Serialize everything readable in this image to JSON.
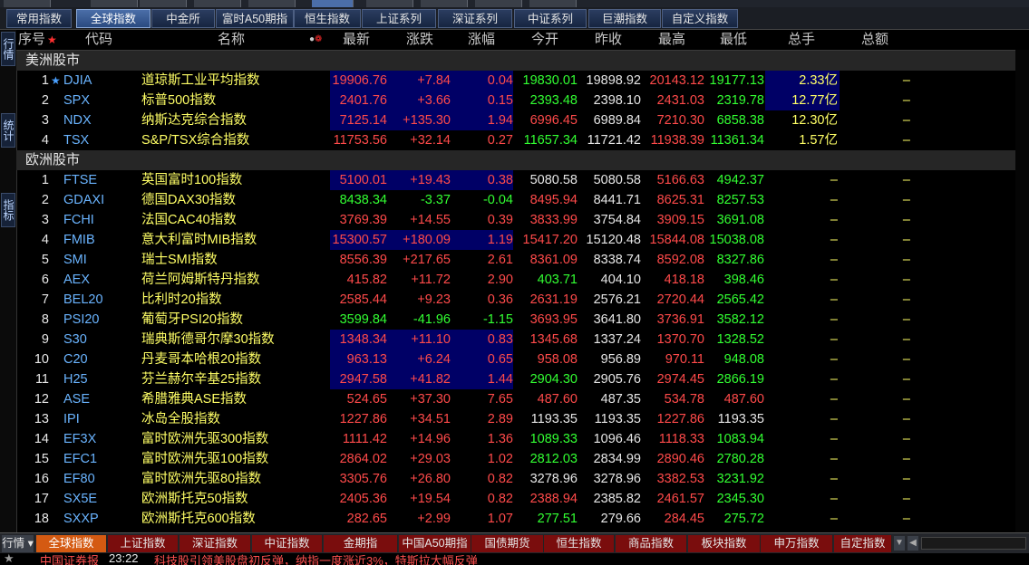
{
  "top_strip_tabs": [
    "...",
    "...",
    "...",
    "...",
    "...",
    "...",
    "...",
    "...",
    "...",
    "..."
  ],
  "category_tabs": [
    "常用指数",
    "全球指数",
    "中金所",
    "富时A50期指",
    "恒生指数",
    "上证系列",
    "深证系列",
    "中证系列",
    "巨潮指数",
    "自定义指数"
  ],
  "active_category": "全球指数",
  "sidebar_tabs": [
    "行情",
    "统计",
    "指标"
  ],
  "columns": {
    "seq": "序号",
    "code": "代码",
    "name": "名称",
    "last": "最新",
    "change": "涨跌",
    "pct": "涨幅",
    "open": "今开",
    "prev": "昨收",
    "high": "最高",
    "low": "最低",
    "volume": "总手",
    "amount": "总额"
  },
  "sections": [
    {
      "title": "美洲股市",
      "rows": [
        {
          "seq": "1",
          "star": "★",
          "code": "DJIA",
          "name": "道琼斯工业平均指数",
          "last": "19906.76",
          "chg": "+7.84",
          "pct": "0.04",
          "open": "19830.01",
          "prev": "19898.92",
          "high": "20143.12",
          "low": "19177.13",
          "vol": "2.33亿",
          "amt": "–",
          "dir": "up",
          "open_dir": "dn",
          "high_dir": "up",
          "low_dir": "dn",
          "hl": true,
          "hl_vol": true
        },
        {
          "seq": "2",
          "star": "",
          "code": "SPX",
          "name": "标普500指数",
          "last": "2401.76",
          "chg": "+3.66",
          "pct": "0.15",
          "open": "2393.48",
          "prev": "2398.10",
          "high": "2431.03",
          "low": "2319.78",
          "vol": "12.77亿",
          "amt": "–",
          "dir": "up",
          "open_dir": "dn",
          "high_dir": "up",
          "low_dir": "dn",
          "hl": true,
          "hl_vol": true
        },
        {
          "seq": "3",
          "star": "",
          "code": "NDX",
          "name": "纳斯达克综合指数",
          "last": "7125.14",
          "chg": "+135.30",
          "pct": "1.94",
          "open": "6996.45",
          "prev": "6989.84",
          "high": "7210.30",
          "low": "6858.38",
          "vol": "12.30亿",
          "amt": "–",
          "dir": "up",
          "open_dir": "up",
          "high_dir": "up",
          "low_dir": "dn",
          "hl": true,
          "hl_vol": false
        },
        {
          "seq": "4",
          "star": "",
          "code": "TSX",
          "name": "S&P/TSX综合指数",
          "last": "11753.56",
          "chg": "+32.14",
          "pct": "0.27",
          "open": "11657.34",
          "prev": "11721.42",
          "high": "11938.39",
          "low": "11361.34",
          "vol": "1.57亿",
          "amt": "–",
          "dir": "up",
          "open_dir": "dn",
          "high_dir": "up",
          "low_dir": "dn",
          "hl": false,
          "hl_vol": false
        }
      ]
    },
    {
      "title": "欧洲股市",
      "rows": [
        {
          "seq": "1",
          "star": "",
          "code": "FTSE",
          "name": "英国富时100指数",
          "last": "5100.01",
          "chg": "+19.43",
          "pct": "0.38",
          "open": "5080.58",
          "prev": "5080.58",
          "high": "5166.63",
          "low": "4942.37",
          "vol": "–",
          "amt": "–",
          "dir": "up",
          "open_dir": "eq",
          "high_dir": "up",
          "low_dir": "dn",
          "hl": true
        },
        {
          "seq": "2",
          "star": "",
          "code": "GDAXI",
          "name": "德国DAX30指数",
          "last": "8438.34",
          "chg": "-3.37",
          "pct": "-0.04",
          "open": "8495.94",
          "prev": "8441.71",
          "high": "8625.31",
          "low": "8257.53",
          "vol": "–",
          "amt": "–",
          "dir": "dn",
          "open_dir": "up",
          "high_dir": "up",
          "low_dir": "dn",
          "hl": false
        },
        {
          "seq": "3",
          "star": "",
          "code": "FCHI",
          "name": "法国CAC40指数",
          "last": "3769.39",
          "chg": "+14.55",
          "pct": "0.39",
          "open": "3833.99",
          "prev": "3754.84",
          "high": "3909.15",
          "low": "3691.08",
          "vol": "–",
          "amt": "–",
          "dir": "up",
          "open_dir": "up",
          "high_dir": "up",
          "low_dir": "dn",
          "hl": false
        },
        {
          "seq": "4",
          "star": "",
          "code": "FMIB",
          "name": "意大利富时MIB指数",
          "last": "15300.57",
          "chg": "+180.09",
          "pct": "1.19",
          "open": "15417.20",
          "prev": "15120.48",
          "high": "15844.08",
          "low": "15038.08",
          "vol": "–",
          "amt": "–",
          "dir": "up",
          "open_dir": "up",
          "high_dir": "up",
          "low_dir": "dn",
          "hl": true
        },
        {
          "seq": "5",
          "star": "",
          "code": "SMI",
          "name": "瑞士SMI指数",
          "last": "8556.39",
          "chg": "+217.65",
          "pct": "2.61",
          "open": "8361.09",
          "prev": "8338.74",
          "high": "8592.08",
          "low": "8327.86",
          "vol": "–",
          "amt": "–",
          "dir": "up",
          "open_dir": "up",
          "high_dir": "up",
          "low_dir": "dn",
          "hl": false
        },
        {
          "seq": "6",
          "star": "",
          "code": "AEX",
          "name": "荷兰阿姆斯特丹指数",
          "last": "415.82",
          "chg": "+11.72",
          "pct": "2.90",
          "open": "403.71",
          "prev": "404.10",
          "high": "418.18",
          "low": "398.46",
          "vol": "–",
          "amt": "–",
          "dir": "up",
          "open_dir": "dn",
          "high_dir": "up",
          "low_dir": "dn",
          "hl": false
        },
        {
          "seq": "7",
          "star": "",
          "code": "BEL20",
          "name": "比利时20指数",
          "last": "2585.44",
          "chg": "+9.23",
          "pct": "0.36",
          "open": "2631.19",
          "prev": "2576.21",
          "high": "2720.44",
          "low": "2565.42",
          "vol": "–",
          "amt": "–",
          "dir": "up",
          "open_dir": "up",
          "high_dir": "up",
          "low_dir": "dn",
          "hl": false
        },
        {
          "seq": "8",
          "star": "",
          "code": "PSI20",
          "name": "葡萄牙PSI20指数",
          "last": "3599.84",
          "chg": "-41.96",
          "pct": "-1.15",
          "open": "3693.95",
          "prev": "3641.80",
          "high": "3736.91",
          "low": "3582.12",
          "vol": "–",
          "amt": "–",
          "dir": "dn",
          "open_dir": "up",
          "high_dir": "up",
          "low_dir": "dn",
          "hl": false
        },
        {
          "seq": "9",
          "star": "",
          "code": "S30",
          "name": "瑞典斯德哥尔摩30指数",
          "last": "1348.34",
          "chg": "+11.10",
          "pct": "0.83",
          "open": "1345.68",
          "prev": "1337.24",
          "high": "1370.70",
          "low": "1328.52",
          "vol": "–",
          "amt": "–",
          "dir": "up",
          "open_dir": "up",
          "high_dir": "up",
          "low_dir": "dn",
          "hl": true
        },
        {
          "seq": "10",
          "star": "",
          "code": "C20",
          "name": "丹麦哥本哈根20指数",
          "last": "963.13",
          "chg": "+6.24",
          "pct": "0.65",
          "open": "958.08",
          "prev": "956.89",
          "high": "970.11",
          "low": "948.08",
          "vol": "–",
          "amt": "–",
          "dir": "up",
          "open_dir": "up",
          "high_dir": "up",
          "low_dir": "dn",
          "hl": true
        },
        {
          "seq": "11",
          "star": "",
          "code": "H25",
          "name": "芬兰赫尔辛基25指数",
          "last": "2947.58",
          "chg": "+41.82",
          "pct": "1.44",
          "open": "2904.30",
          "prev": "2905.76",
          "high": "2974.45",
          "low": "2866.19",
          "vol": "–",
          "amt": "–",
          "dir": "up",
          "open_dir": "dn",
          "high_dir": "up",
          "low_dir": "dn",
          "hl": true
        },
        {
          "seq": "12",
          "star": "",
          "code": "ASE",
          "name": "希腊雅典ASE指数",
          "last": "524.65",
          "chg": "+37.30",
          "pct": "7.65",
          "open": "487.60",
          "prev": "487.35",
          "high": "534.78",
          "low": "487.60",
          "vol": "–",
          "amt": "–",
          "dir": "up",
          "open_dir": "up",
          "high_dir": "up",
          "low_dir": "up",
          "hl": false
        },
        {
          "seq": "13",
          "star": "",
          "code": "IPI",
          "name": "冰岛全股指数",
          "last": "1227.86",
          "chg": "+34.51",
          "pct": "2.89",
          "open": "1193.35",
          "prev": "1193.35",
          "high": "1227.86",
          "low": "1193.35",
          "vol": "–",
          "amt": "–",
          "dir": "up",
          "open_dir": "eq",
          "high_dir": "up",
          "low_dir": "eq",
          "hl": false
        },
        {
          "seq": "14",
          "star": "",
          "code": "EF3X",
          "name": "富时欧洲先驱300指数",
          "last": "1111.42",
          "chg": "+14.96",
          "pct": "1.36",
          "open": "1089.33",
          "prev": "1096.46",
          "high": "1118.33",
          "low": "1083.94",
          "vol": "–",
          "amt": "–",
          "dir": "up",
          "open_dir": "dn",
          "high_dir": "up",
          "low_dir": "dn",
          "hl": false
        },
        {
          "seq": "15",
          "star": "",
          "code": "EFC1",
          "name": "富时欧洲先驱100指数",
          "last": "2864.02",
          "chg": "+29.03",
          "pct": "1.02",
          "open": "2812.03",
          "prev": "2834.99",
          "high": "2890.46",
          "low": "2780.28",
          "vol": "–",
          "amt": "–",
          "dir": "up",
          "open_dir": "dn",
          "high_dir": "up",
          "low_dir": "dn",
          "hl": false
        },
        {
          "seq": "16",
          "star": "",
          "code": "EF80",
          "name": "富时欧洲先驱80指数",
          "last": "3305.76",
          "chg": "+26.80",
          "pct": "0.82",
          "open": "3278.96",
          "prev": "3278.96",
          "high": "3382.53",
          "low": "3231.92",
          "vol": "–",
          "amt": "–",
          "dir": "up",
          "open_dir": "eq",
          "high_dir": "up",
          "low_dir": "dn",
          "hl": false
        },
        {
          "seq": "17",
          "star": "",
          "code": "SX5E",
          "name": "欧洲斯托克50指数",
          "last": "2405.36",
          "chg": "+19.54",
          "pct": "0.82",
          "open": "2388.94",
          "prev": "2385.82",
          "high": "2461.57",
          "low": "2345.30",
          "vol": "–",
          "amt": "–",
          "dir": "up",
          "open_dir": "up",
          "high_dir": "up",
          "low_dir": "dn",
          "hl": false
        },
        {
          "seq": "18",
          "star": "",
          "code": "SXXP",
          "name": "欧洲斯托克600指数",
          "last": "282.65",
          "chg": "+2.99",
          "pct": "1.07",
          "open": "277.51",
          "prev": "279.66",
          "high": "284.45",
          "low": "275.72",
          "vol": "–",
          "amt": "–",
          "dir": "up",
          "open_dir": "dn",
          "high_dir": "up",
          "low_dir": "dn",
          "hl": false
        }
      ]
    }
  ],
  "bottom_tabs": [
    "行情",
    "全球指数",
    "上证指数",
    "深证指数",
    "中证指数",
    "金期指",
    "中国A50期指",
    "国债期货",
    "恒生指数",
    "商品指数",
    "板块指数",
    "申万指数",
    "自定指数"
  ],
  "active_bottom_tab": "全球指数",
  "ticker": {
    "source": "中国证券报",
    "time": "23:22",
    "text": "科技股引领美股盘初反弹，纳指一度涨近3%，特斯拉大幅反弹"
  },
  "colors": {
    "up": "#ff4a4a",
    "down": "#32ff32",
    "flat": "#e6e6e6",
    "highlight_bg": "#000066",
    "section_bg": "#262626",
    "code": "#6ab4ff",
    "name": "#ffff66"
  }
}
